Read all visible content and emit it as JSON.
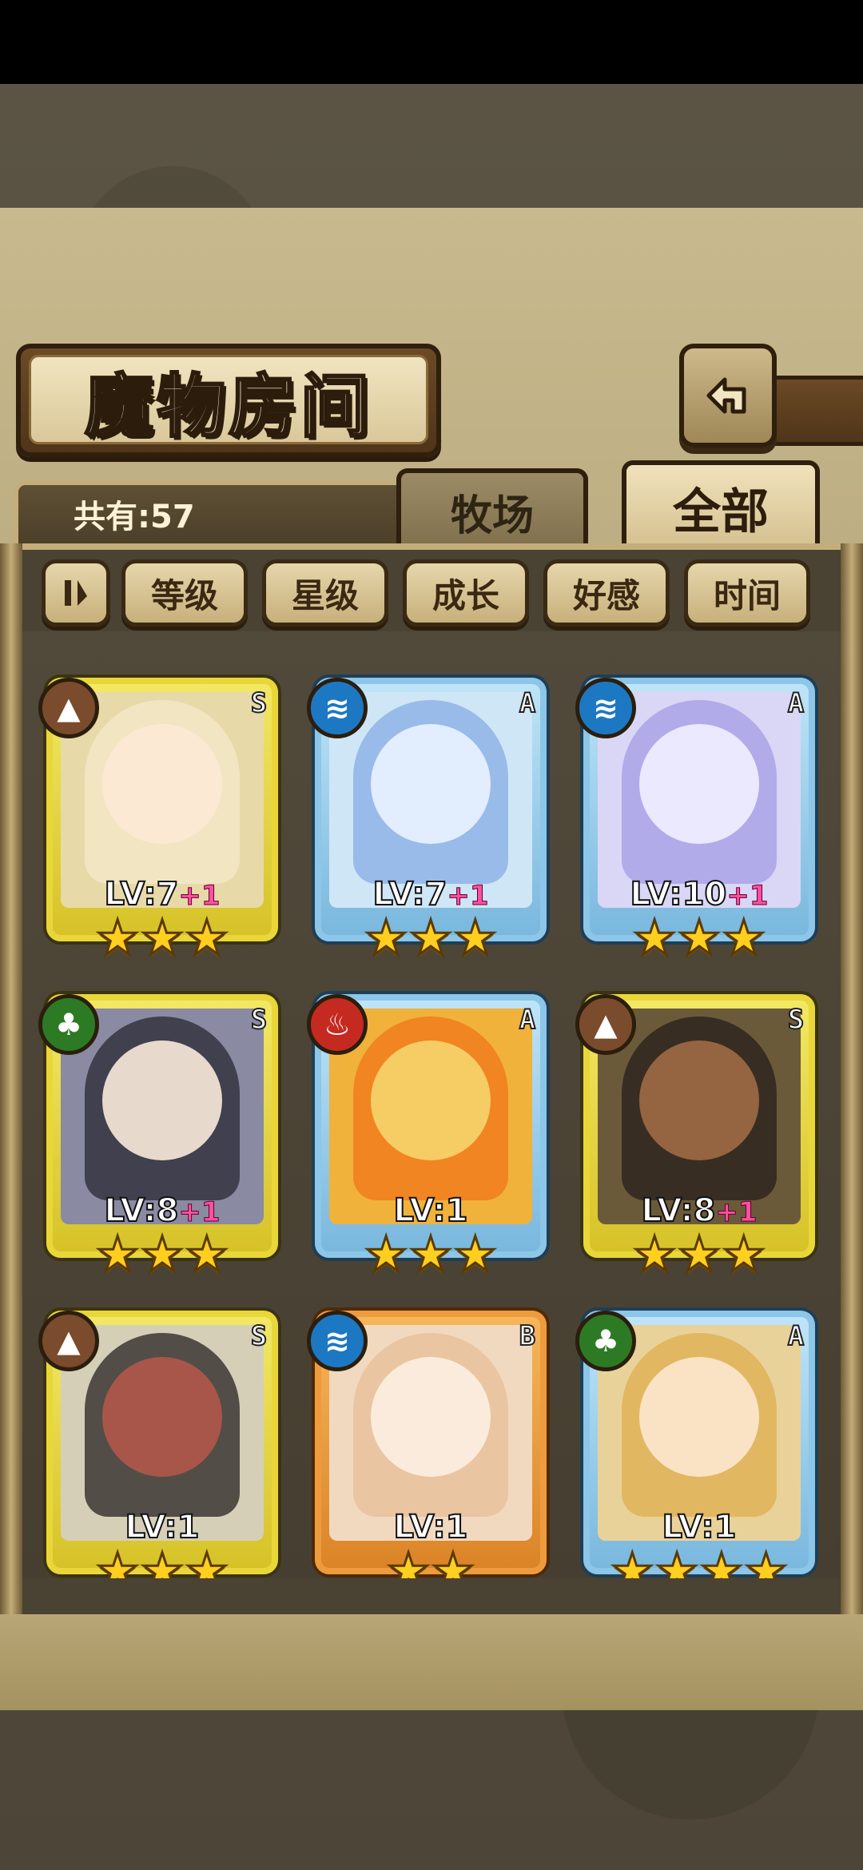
{
  "header": {
    "title": "魔物房间",
    "back_icon": "back-arrow-icon"
  },
  "summary": {
    "count_label": "共有:57"
  },
  "tabs": [
    {
      "label": "牧场",
      "selected": false
    },
    {
      "label": "全部",
      "selected": true
    }
  ],
  "sort": {
    "toggle_icon": "sort-order-icon",
    "options": [
      "等级",
      "星级",
      "成长",
      "好感",
      "时间"
    ]
  },
  "colors": {
    "rank_S": "#e9d73a",
    "rank_A": "#8cc6e8",
    "rank_B": "#ee9b3d",
    "plus_level": "#ff4fa0",
    "star": "#ffcf1f"
  },
  "monsters": [
    {
      "element": "earth-icon",
      "rank": "S",
      "level": "LV:7",
      "plus": "+1",
      "stars": 3
    },
    {
      "element": "water-icon",
      "rank": "A",
      "level": "LV:7",
      "plus": "+1",
      "stars": 3
    },
    {
      "element": "water-icon",
      "rank": "A",
      "level": "LV:10",
      "plus": "+1",
      "stars": 3
    },
    {
      "element": "wood-icon",
      "rank": "S",
      "level": "LV:8",
      "plus": "+1",
      "stars": 3
    },
    {
      "element": "fire-icon",
      "rank": "A",
      "level": "LV:1",
      "plus": "",
      "stars": 3
    },
    {
      "element": "earth-icon",
      "rank": "S",
      "level": "LV:8",
      "plus": "+1",
      "stars": 3
    },
    {
      "element": "earth-icon",
      "rank": "S",
      "level": "LV:1",
      "plus": "",
      "stars": 3
    },
    {
      "element": "water-icon",
      "rank": "B",
      "level": "LV:1",
      "plus": "",
      "stars": 2
    },
    {
      "element": "wood-icon",
      "rank": "A",
      "level": "LV:1",
      "plus": "",
      "stars": 4
    }
  ]
}
